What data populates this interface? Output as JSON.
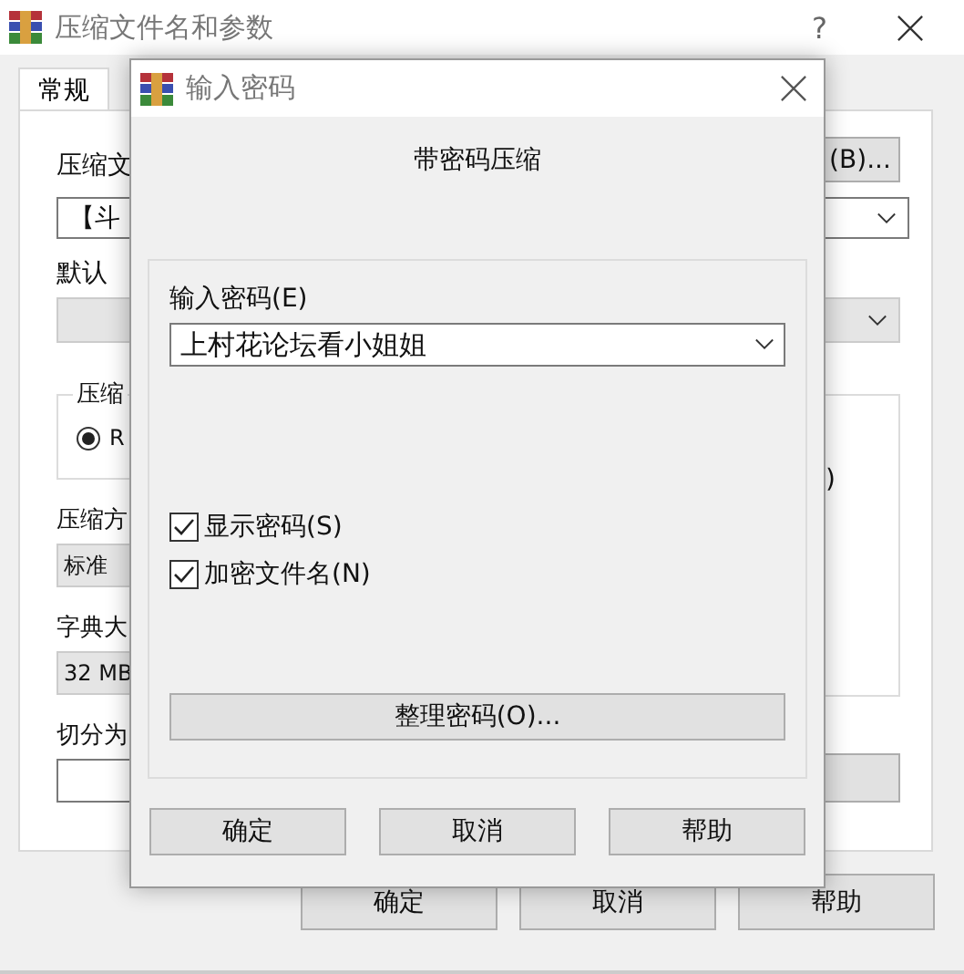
{
  "main_window": {
    "title": "压缩文件名和参数",
    "help_button": "?",
    "tabs": [
      {
        "label": "常规",
        "selected": true
      }
    ],
    "archive_name_label": "压缩文",
    "browse_button": "(B)...",
    "archive_name_value": "【斗",
    "profile_label": "默认",
    "format_group_label": "压缩",
    "format_options": [
      {
        "label": "R",
        "selected": true
      }
    ],
    "options_fragment": ")",
    "method_label": "压缩方",
    "method_value": "标准",
    "dictionary_label": "字典大",
    "dictionary_value": "32 MB",
    "split_label": "切分为",
    "buttons": [
      "确定",
      "取消",
      "帮助"
    ]
  },
  "password_dialog": {
    "title": "输入密码",
    "heading": "带密码压缩",
    "password_label": "输入密码(E)",
    "password_value": "上村花论坛看小姐姐",
    "options": [
      {
        "label": "显示密码(S)",
        "checked": true
      },
      {
        "label": "加密文件名(N)",
        "checked": true
      }
    ],
    "organize_button": "整理密码(O)...",
    "buttons": [
      "确定",
      "取消",
      "帮助"
    ]
  }
}
